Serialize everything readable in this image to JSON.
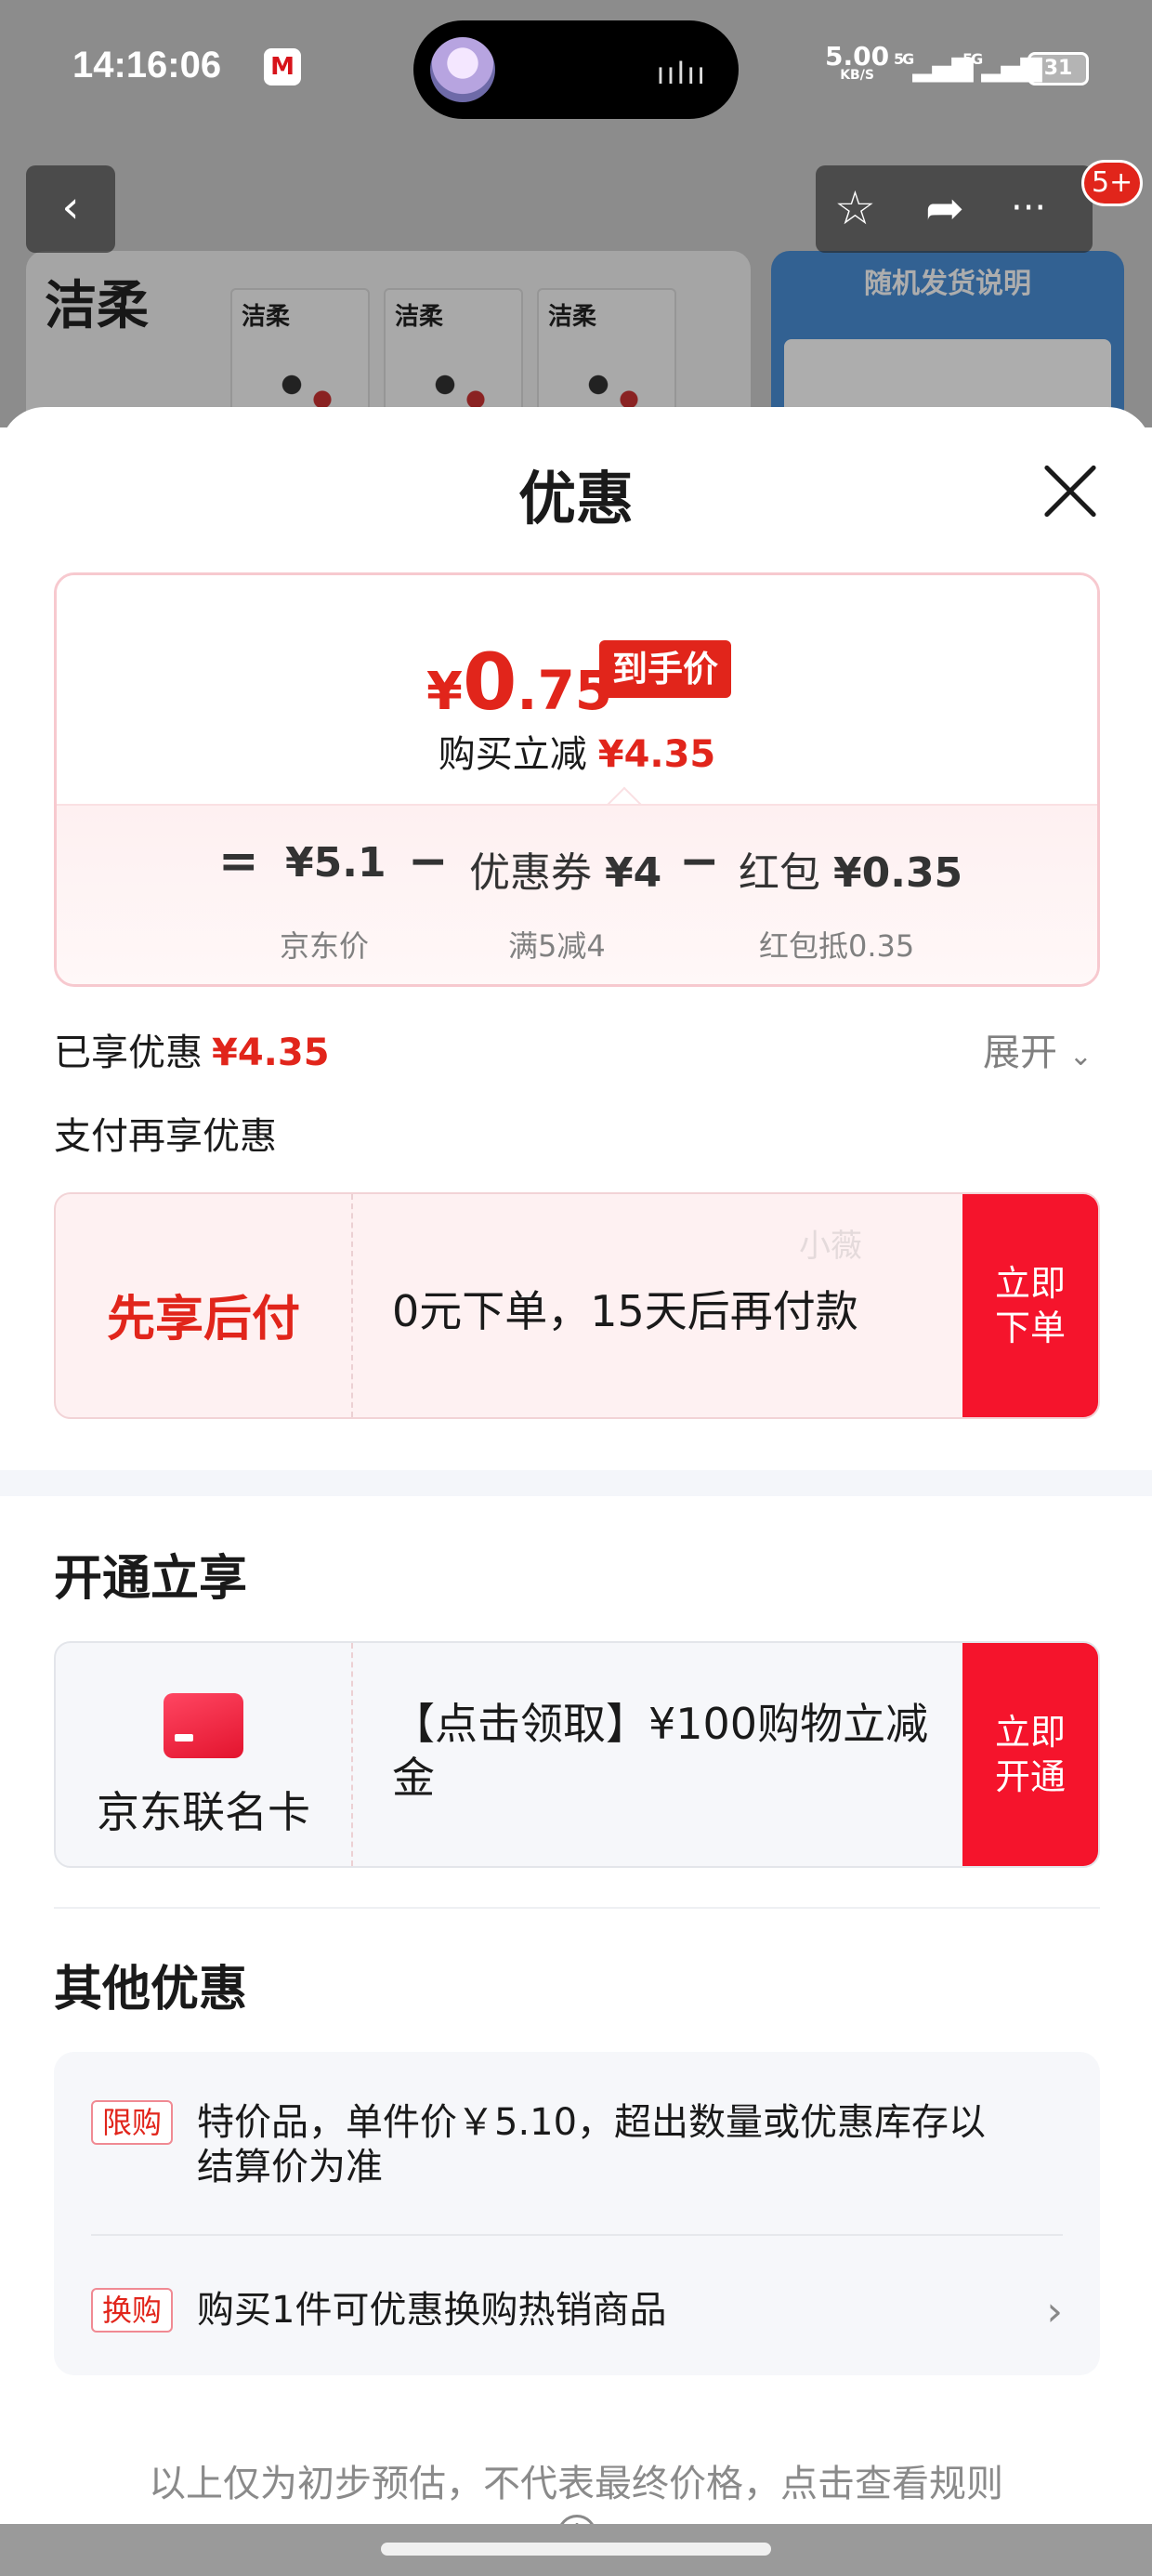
{
  "status_bar": {
    "time": "14:16:06",
    "app_icon": "M",
    "net_speed": "5.00",
    "net_unit": "KB/S",
    "sig1": "5G",
    "sig2": "5G",
    "battery": "31"
  },
  "product_bg": {
    "brand": "洁柔",
    "pack_brand": "洁柔",
    "right_title": "随机发货说明"
  },
  "header": {
    "badge": "5+"
  },
  "sheet": {
    "title": "优惠"
  },
  "price_card": {
    "yen": "¥",
    "price_int": "0",
    "price_dec": ".75",
    "price_tag": "到手价",
    "instant_label": "购买立减",
    "instant_value": "¥4.35",
    "eq": "=",
    "minus": "−",
    "jd_price": "¥5.1",
    "jd_price_label": "京东价",
    "coupon_label": "优惠券",
    "coupon_value": "¥4",
    "coupon_sub": "满5减4",
    "redpacket_label": "红包",
    "redpacket_value": "¥0.35",
    "redpacket_sub": "红包抵0.35"
  },
  "enjoyed": {
    "label": "已享优惠",
    "value": "¥4.35",
    "expand_label": "展开"
  },
  "pay_more": {
    "title": "支付再享优惠",
    "name": "先享后付",
    "desc": "0元下单，15天后再付款",
    "watermark": "小薇",
    "button": "立即\n下单"
  },
  "open_section": {
    "title": "开通立享",
    "card_name": "京东联名卡",
    "desc": "【点击领取】¥100购物立减金",
    "button": "立即\n开通"
  },
  "other_section": {
    "title": "其他优惠",
    "items": [
      {
        "tag": "限购",
        "text": "特价品，单件价￥5.10，超出数量或优惠库存以结算价为准"
      },
      {
        "tag": "换购",
        "text": "购买1件可优惠换购热销商品"
      }
    ]
  },
  "disclaimer": "以上仅为初步预估，不代表最终价格，点击查看规则",
  "colors": {
    "accent_red": "#e1251b",
    "button_red": "#f5142c"
  }
}
